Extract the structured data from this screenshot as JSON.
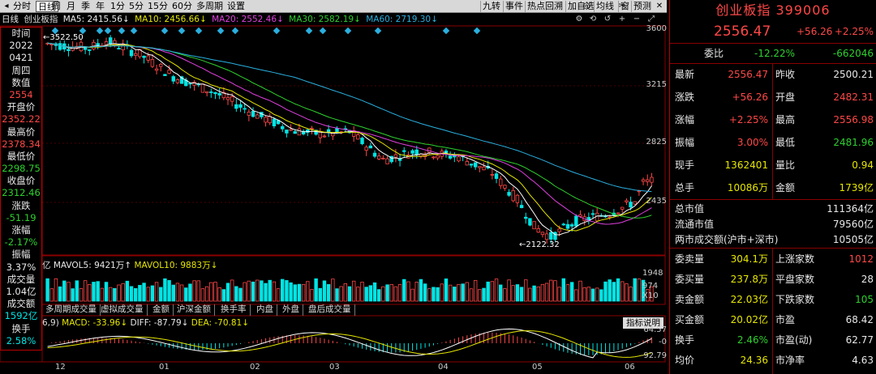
{
  "toolbar": {
    "tabs": [
      "分时",
      "日线",
      "周",
      "月",
      "季",
      "年",
      "1分",
      "5分",
      "15分",
      "60分",
      "多周期",
      "设置"
    ],
    "selected": "日线",
    "right_tools": [
      "九转",
      "事件",
      "热点回溯",
      "加自选",
      "均线",
      "窗",
      "预测"
    ]
  },
  "chart_label": "日线",
  "ma_line": {
    "name": "创业板指",
    "ma5": "MA5: 2415.56↓",
    "ma10": "MA10: 2456.66↓",
    "ma20": "MA20: 2552.46↓",
    "ma30": "MA30: 2582.19↓",
    "ma60": "MA60: 2719.30↓"
  },
  "left_panel": [
    {
      "label": "时间",
      "value": "2022"
    },
    {
      "label": "",
      "value": "0421"
    },
    {
      "label": "周四",
      "value": ""
    },
    {
      "label": "数值",
      "value": "2554"
    },
    {
      "label": "开盘价",
      "value": "2352.22"
    },
    {
      "label": "最高价",
      "value": "2378.34"
    },
    {
      "label": "最低价",
      "value": "2298.75"
    },
    {
      "label": "收盘价",
      "value": "2312.46"
    },
    {
      "label": "涨跌",
      "value": "-51.19"
    },
    {
      "label": "涨幅",
      "value": "-2.17%"
    },
    {
      "label": "振幅",
      "value": "3.37%"
    },
    {
      "label": "成交量",
      "value": "1.04亿"
    },
    {
      "label": "成交额",
      "value": "1592亿"
    },
    {
      "label": "换手",
      "value": "2.58%"
    }
  ],
  "price_axis": [
    "3600",
    "3215",
    "2825",
    "2435"
  ],
  "high_label": "3522.50",
  "low_label": "2122.32",
  "vol_legend": {
    "title": "亿",
    "mavol5": "MAVOL5: 9421万↑",
    "mavol10": "MAVOL10: 9883万↓"
  },
  "vol_axis": [
    "1948",
    "974",
    "X10"
  ],
  "vol_tabs": [
    "多周期成交量",
    "虚拟成交量",
    "金额",
    "沪深金额",
    "换手率",
    "内盘",
    "外盘",
    "盘后成交量"
  ],
  "macd_legend": {
    "params": "6,9)",
    "macd": "MACD: -33.96↓",
    "diff": "DIFF: -87.79↓",
    "dea": "DEA: -70.81↓"
  },
  "macd_axis": [
    "64.57",
    "-0",
    "-92.79"
  ],
  "help_label": "指标说明",
  "date_axis": [
    "12",
    "01",
    "02",
    "03",
    "04",
    "05",
    "06"
  ],
  "right": {
    "title": "创业板指 399006",
    "price": "2556.47",
    "change": "+56.26",
    "change_pct": "+2.25%",
    "weibi_label": "委比",
    "weibi": "-12.22%",
    "weicha": "-662046",
    "rows": [
      [
        "最新",
        "2556.47",
        "昨收",
        "2500.21"
      ],
      [
        "涨跌",
        "+56.26",
        "开盘",
        "2482.31"
      ],
      [
        "涨幅",
        "+2.25%",
        "最高",
        "2556.98"
      ],
      [
        "振幅",
        "3.00%",
        "最低",
        "2481.96"
      ],
      [
        "现手",
        "1362401",
        "量比",
        "0.94"
      ],
      [
        "总手",
        "10086万",
        "金额",
        "1739亿"
      ]
    ],
    "mkt": [
      [
        "总市值",
        "111364亿"
      ],
      [
        "流通市值",
        "79560亿"
      ],
      [
        "两市成交额(沪市+深市)",
        "10505亿"
      ]
    ],
    "book": [
      [
        "委卖量",
        "304.1万",
        "上涨家数",
        "1012"
      ],
      [
        "委买量",
        "237.8万",
        "平盘家数",
        "28"
      ],
      [
        "卖金额",
        "22.03亿",
        "下跌家数",
        "105"
      ],
      [
        "买金额",
        "20.02亿",
        "市盈",
        "68.42"
      ],
      [
        "换手",
        "2.46%",
        "市盈(动)",
        "62.77"
      ],
      [
        "均价",
        "24.36",
        "市净率",
        "4.63"
      ]
    ]
  },
  "colors": {
    "up": "#ff4747",
    "down": "#00e5e5",
    "ma5": "#ffffff",
    "ma10": "#e6e600",
    "ma20": "#e040e0",
    "ma30": "#2ed02e",
    "ma60": "#2ab0e0"
  }
}
